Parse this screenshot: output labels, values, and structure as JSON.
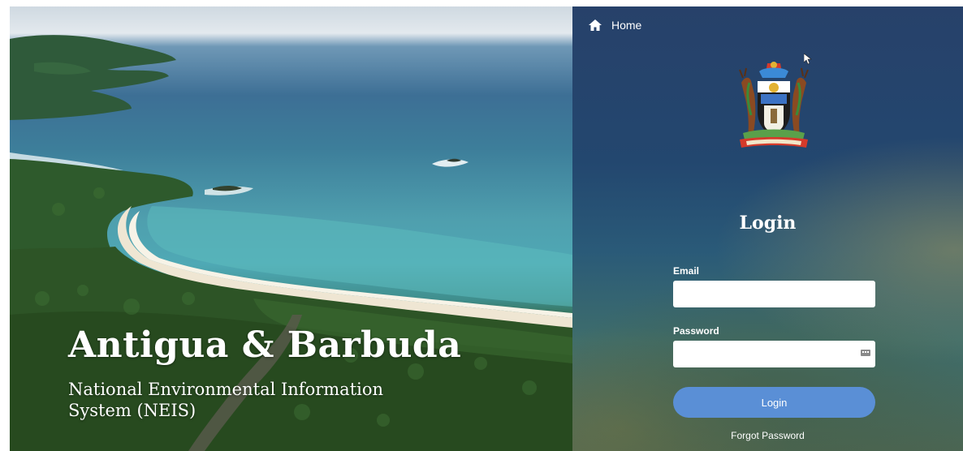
{
  "hero": {
    "title": "Antigua & Barbuda",
    "subtitle": "National Environmental Information System (NEIS)"
  },
  "nav": {
    "home_label": "Home",
    "home_icon": "home-icon"
  },
  "login": {
    "heading": "Login",
    "email_label": "Email",
    "email_value": "",
    "password_label": "Password",
    "password_value": "",
    "password_manager_icon": "key-icon",
    "submit_label": "Login",
    "forgot_label": "Forgot Password"
  },
  "colors": {
    "button": "#5a8fd6",
    "panel_top": "#27416a",
    "text": "#ffffff"
  }
}
